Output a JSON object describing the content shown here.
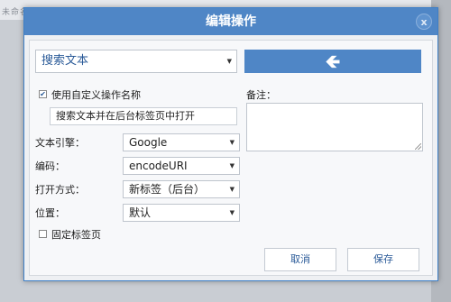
{
  "background": {
    "text": "未命名的标签"
  },
  "dialog": {
    "title": "编辑操作",
    "close_glyph": "x",
    "action": {
      "selected": "搜索文本"
    },
    "back_button_glyph": "🡸",
    "custom_name": {
      "checked": true,
      "label": "使用自定义操作名称",
      "value": "搜索文本并在后台标签页中打开"
    },
    "fields": [
      {
        "label": "文本引擎：",
        "value": "Google"
      },
      {
        "label": "编码：",
        "value": "encodeURI"
      },
      {
        "label": "打开方式：",
        "value": "新标签（后台）"
      },
      {
        "label": "位置：",
        "value": "默认"
      }
    ],
    "pin_tab": {
      "checked": false,
      "label": "固定标签页"
    },
    "note": {
      "label": "备注：",
      "value": ""
    },
    "buttons": {
      "cancel": "取消",
      "save": "保存"
    }
  },
  "colors": {
    "accent": "#4f86c6",
    "link": "#2a5a98"
  }
}
